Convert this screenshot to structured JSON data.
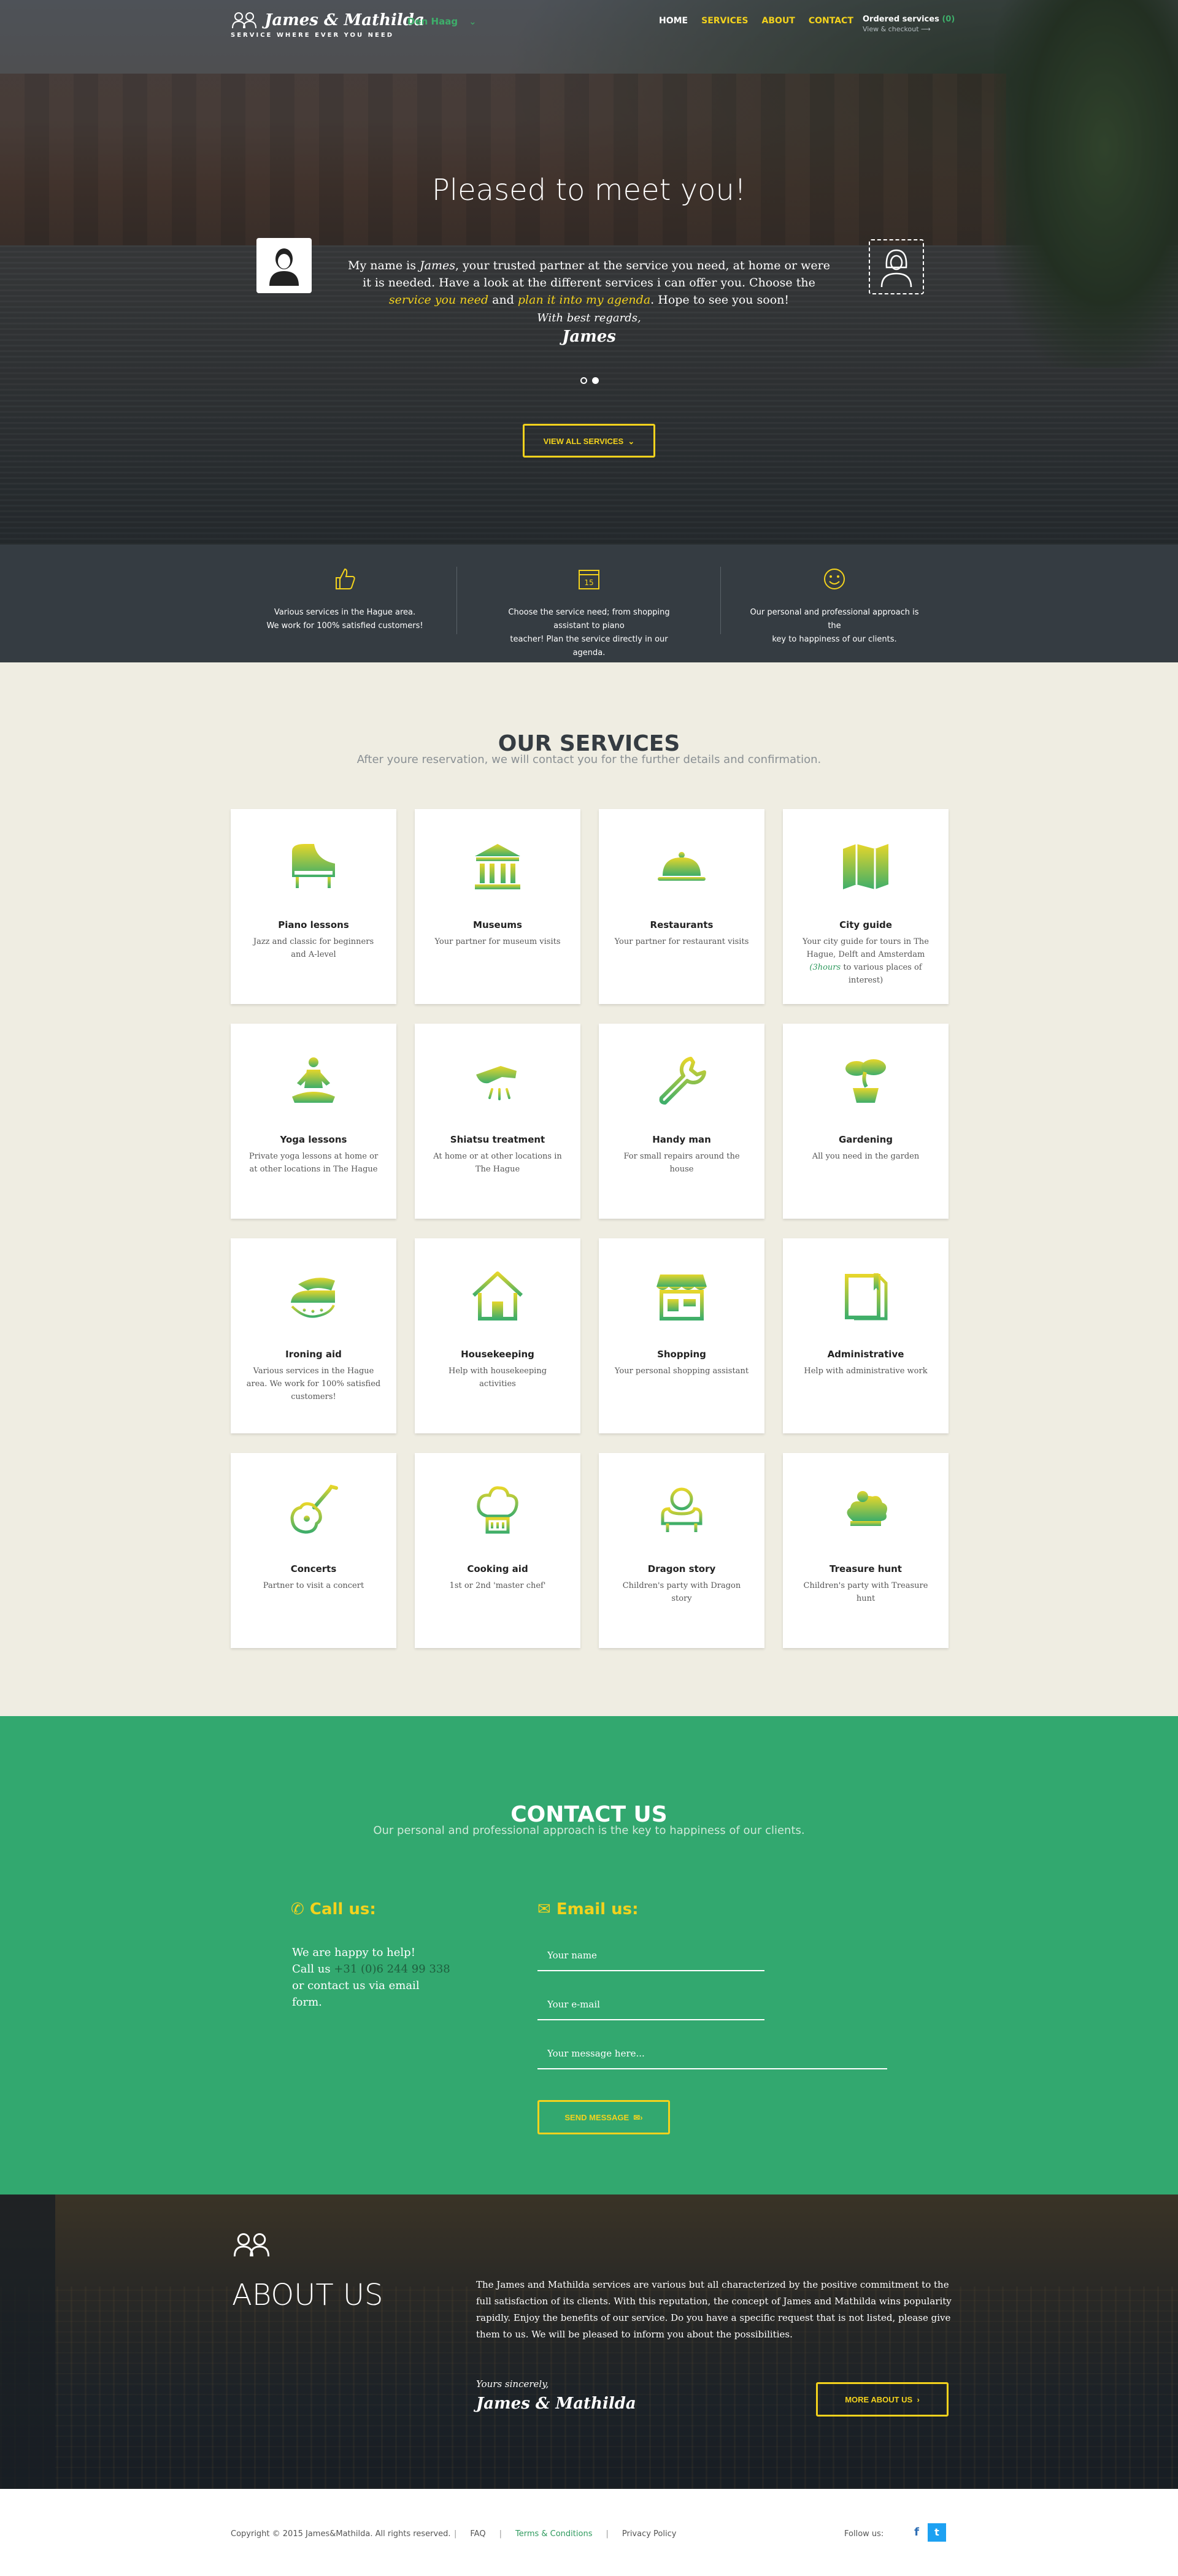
{
  "brand": {
    "name": "James & Mathilda",
    "tagline": "SERVICE WHERE EVER YOU NEED"
  },
  "nav": {
    "city": "Den Haag",
    "items": [
      {
        "label": "HOME"
      },
      {
        "label": "SERVICES"
      },
      {
        "label": "ABOUT"
      },
      {
        "label": "CONTACT"
      }
    ],
    "ordered_label": "Ordered services",
    "ordered_count": "(0)",
    "ordered_sub": "View & checkout"
  },
  "hero": {
    "title": "Pleased to meet you!",
    "intro_1": "My name is ",
    "intro_name": "James",
    "intro_2": ", your trusted partner at the service you need, at home or were it is needed. Have a look at the different services i can offer you. Choose the ",
    "intro_hl1": "service you need",
    "intro_3": " and ",
    "intro_hl2": "plan it into my agenda",
    "intro_4": ". Hope to see you soon!",
    "regards": "With best regards,",
    "signature": "James",
    "button": "VIEW ALL SERVICES"
  },
  "features": [
    {
      "icon": "thumbs-up-icon",
      "line1": "Various services in the Hague area.",
      "line2": "We work for 100% satisfied customers!"
    },
    {
      "icon": "calendar-icon",
      "line1": "Choose the service need; from shopping assistant to piano",
      "line2": "teacher! Plan the service directly in our agenda."
    },
    {
      "icon": "smiley-icon",
      "line1": "Our personal and professional approach is the",
      "line2": "key to happiness of our clients."
    }
  ],
  "services": {
    "title": "OUR SERVICES",
    "subtitle": "After youre reservation, we will contact you for the further details and confirmation.",
    "items": [
      {
        "icon": "piano-icon",
        "title": "Piano lessons",
        "desc": "Jazz and classic for beginners and A-level"
      },
      {
        "icon": "museum-icon",
        "title": "Museums",
        "desc": "Your partner for museum visits"
      },
      {
        "icon": "cloche-icon",
        "title": "Restaurants",
        "desc": "Your partner for restaurant visits"
      },
      {
        "icon": "map-icon",
        "title": "City guide",
        "desc": "Your city guide for tours in The Hague, Delft and Amsterdam",
        "desc_hl": "(3hours",
        "desc_tail": " to various places of interest)"
      },
      {
        "icon": "yoga-icon",
        "title": "Yoga lessons",
        "desc": "Private yoga lessons at home or at other locations in The Hague"
      },
      {
        "icon": "massage-icon",
        "title": "Shiatsu treatment",
        "desc": "At home or at other locations in The Hague"
      },
      {
        "icon": "wrench-icon",
        "title": "Handy man",
        "desc": "For small repairs around the house"
      },
      {
        "icon": "bonsai-icon",
        "title": "Gardening",
        "desc": "All you need in the garden"
      },
      {
        "icon": "iron-icon",
        "title": "Ironing aid",
        "desc": "Various services in the Hague area. We work for 100% satisfied customers!"
      },
      {
        "icon": "house-icon",
        "title": "Housekeeping",
        "desc": "Help with housekeeping activities"
      },
      {
        "icon": "shop-icon",
        "title": "Shopping",
        "desc": "Your personal shopping assistant"
      },
      {
        "icon": "document-icon",
        "title": "Administrative",
        "desc": "Help with administrative work"
      },
      {
        "icon": "guitar-icon",
        "title": "Concerts",
        "desc": "Partner to visit a concert"
      },
      {
        "icon": "chef-hat-icon",
        "title": "Cooking aid",
        "desc": "1st or 2nd 'master chef'"
      },
      {
        "icon": "dragon-icon",
        "title": "Dragon story",
        "desc": "Children's party with Dragon story"
      },
      {
        "icon": "treasure-icon",
        "title": "Treasure hunt",
        "desc": "Children's party with Treasure hunt"
      }
    ]
  },
  "contact": {
    "title": "CONTACT US",
    "subtitle": "Our personal and professional approach is the key to happiness of our clients.",
    "call_heading": "Call us:",
    "call_line1": "We are happy to help!",
    "call_line2a": "Call us ",
    "phone": "+31 (0)6 244 99 338",
    "call_line2b": " or contact us via email form.",
    "email_heading": "Email us:",
    "name_placeholder": "Your name",
    "email_placeholder": "Your e-mail",
    "message_placeholder": "Your message here...",
    "send_button": "SEND MESSAGE"
  },
  "about": {
    "title": "ABOUT US",
    "text": "The James and Mathilda services are various but all characterized by the positive commitment to the full satisfaction of its clients. With this reputation, the concept of James and Mathilda wins popularity rapidly. Enjoy the benefits of our service. Do you have a specific request that is not listed, please give them to us. We will be pleased to inform you about the possibilities.",
    "sincerely": "Yours sincerely,",
    "signature": "James & Mathilda",
    "button": "MORE ABOUT US"
  },
  "footer": {
    "copyright": "Copyright © 2015 James&Mathilda. All rights reserved.",
    "links": [
      {
        "label": "FAQ"
      },
      {
        "label": "Terms & Conditions"
      },
      {
        "label": "Privacy Policy"
      }
    ],
    "follow": "Follow us:",
    "facebook": "f",
    "twitter": "t"
  },
  "colors": {
    "accent_yellow": "#f3d21d",
    "green": "#32a86f",
    "dark": "#353c42",
    "beige": "#efede2"
  }
}
